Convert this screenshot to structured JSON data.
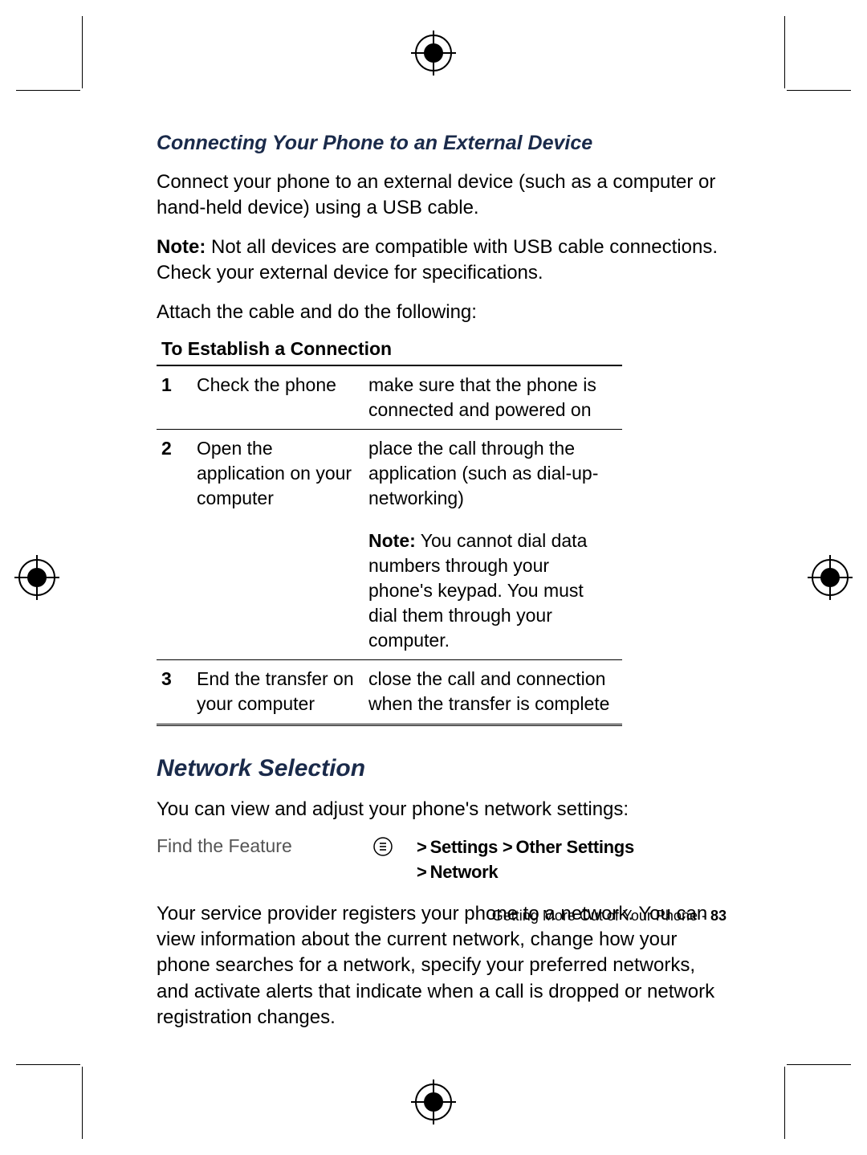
{
  "section1": {
    "heading": "Connecting Your Phone to an External Device",
    "para1": "Connect your phone to an external device (such as a computer or hand-held device) using a USB cable.",
    "note_label": "Note:",
    "note_text": " Not all devices are compatible with USB cable connections. Check your external device for specifications.",
    "para2": "Attach the cable and do the following:"
  },
  "table": {
    "caption": "To Establish a Connection",
    "rows": [
      {
        "num": "1",
        "action": "Check the phone",
        "desc": "make sure that the phone is connected and powered on"
      },
      {
        "num": "2",
        "action": "Open the application on your computer",
        "desc": "place the call through the application (such as dial-up-networking)"
      },
      {
        "num": "3",
        "action": "End the transfer on your computer",
        "desc": "close the call and connection when the transfer is complete"
      }
    ],
    "row2_note_label": "Note:",
    "row2_note_text": " You cannot dial data numbers through your phone's keypad. You must dial them through your computer."
  },
  "section2": {
    "heading": "Network Selection",
    "para1": "You can view and adjust your phone's network settings:",
    "feature_label": "Find the Feature",
    "nav_line1": "> Settings > Other Settings",
    "nav_line2": "> Network",
    "para2": "Your service provider registers your phone to a network. You can view information about the current network, change how your phone searches for a network, specify your preferred networks, and activate alerts that indicate when a call is dropped or network registration changes."
  },
  "footer": {
    "section": "Getting More Out of Your Phone - ",
    "page": "83"
  }
}
